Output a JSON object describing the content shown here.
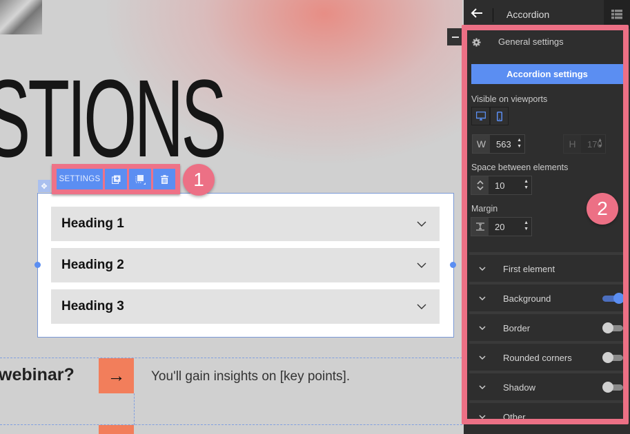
{
  "canvas": {
    "hero_title": "STIONS",
    "webinar_text": "webinar?",
    "arrow_glyph": "→",
    "insight_text": "You'll gain insights on [key points]."
  },
  "toolbar": {
    "settings_label": "SETTINGS",
    "duplicate_icon": "duplicate-icon",
    "layer_icon": "layer-icon",
    "delete_icon": "trash-icon"
  },
  "badges": {
    "one": "1",
    "two": "2"
  },
  "accordion": {
    "items": [
      {
        "heading": "Heading 1"
      },
      {
        "heading": "Heading 2"
      },
      {
        "heading": "Heading 3"
      }
    ]
  },
  "panel": {
    "back_icon": "arrow-left-icon",
    "title": "Accordion",
    "general_settings": "General settings",
    "accordion_settings_button": "Accordion settings",
    "visible_label": "Visible on viewports",
    "width": {
      "label": "W",
      "value": "563"
    },
    "height": {
      "label": "H",
      "value": "170"
    },
    "space_label": "Space between elements",
    "space_value": "10",
    "margin_label": "Margin",
    "margin_value": "20",
    "sections": [
      {
        "label": "First element",
        "toggle": null
      },
      {
        "label": "Background",
        "toggle": true
      },
      {
        "label": "Border",
        "toggle": false
      },
      {
        "label": "Rounded corners",
        "toggle": false
      },
      {
        "label": "Shadow",
        "toggle": false
      },
      {
        "label": "Other",
        "toggle": null
      }
    ]
  },
  "colors": {
    "accent": "#5b8ef2",
    "highlight": "#ec7085",
    "panel_bg": "#2e2e2e",
    "cta": "#f27e5b"
  }
}
